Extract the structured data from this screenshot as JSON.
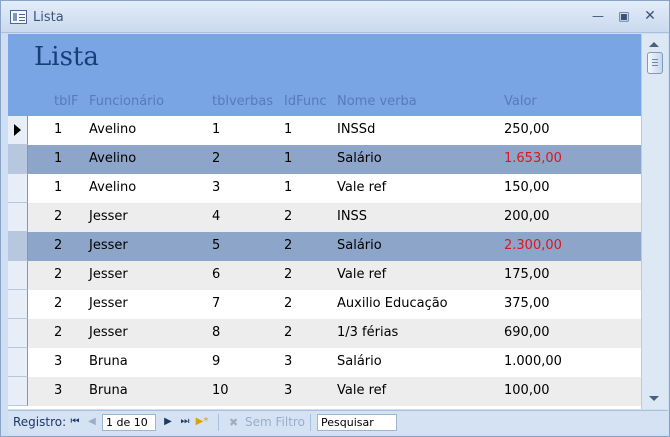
{
  "window": {
    "title": "Lista"
  },
  "form": {
    "title": "Lista"
  },
  "columns": [
    "tblF",
    "Funcionário",
    "tblverbas",
    "IdFunc",
    "Nome verba",
    "Valor"
  ],
  "rows": [
    {
      "tblF": "1",
      "funcionario": "Avelino",
      "tblverbas": "1",
      "idfunc": "1",
      "nome_verba": "INSSd",
      "valor": "250,00"
    },
    {
      "tblF": "1",
      "funcionario": "Avelino",
      "tblverbas": "2",
      "idfunc": "1",
      "nome_verba": "Salário",
      "valor": "1.653,00"
    },
    {
      "tblF": "1",
      "funcionario": "Avelino",
      "tblverbas": "3",
      "idfunc": "1",
      "nome_verba": "Vale ref",
      "valor": "150,00"
    },
    {
      "tblF": "2",
      "funcionario": "Jesser",
      "tblverbas": "4",
      "idfunc": "2",
      "nome_verba": "INSS",
      "valor": "200,00"
    },
    {
      "tblF": "2",
      "funcionario": "Jesser",
      "tblverbas": "5",
      "idfunc": "2",
      "nome_verba": "Salário",
      "valor": "2.300,00"
    },
    {
      "tblF": "2",
      "funcionario": "Jesser",
      "tblverbas": "6",
      "idfunc": "2",
      "nome_verba": "Vale ref",
      "valor": "175,00"
    },
    {
      "tblF": "2",
      "funcionario": "Jesser",
      "tblverbas": "7",
      "idfunc": "2",
      "nome_verba": "Auxilio Educação",
      "valor": "375,00"
    },
    {
      "tblF": "2",
      "funcionario": "Jesser",
      "tblverbas": "8",
      "idfunc": "2",
      "nome_verba": "1/3 férias",
      "valor": "690,00"
    },
    {
      "tblF": "3",
      "funcionario": "Bruna",
      "tblverbas": "9",
      "idfunc": "3",
      "nome_verba": "Salário",
      "valor": "1.000,00"
    },
    {
      "tblF": "3",
      "funcionario": "Bruna",
      "tblverbas": "10",
      "idfunc": "3",
      "nome_verba": "Vale ref",
      "valor": "100,00"
    }
  ],
  "navigation": {
    "label": "Registro:",
    "position": "1 de 10",
    "filter_label": "Sem Filtro",
    "search_placeholder": "Pesquisar"
  },
  "colors": {
    "header_bg": "#7aa5e5",
    "title_color": "#163f78",
    "column_header_color": "#557bb9",
    "highlight_row": "#8ca5c9",
    "alt_row": "#ededed",
    "highlight_value": "#e0141e"
  },
  "icons": {
    "window": "form-icon",
    "minimize": "minimize-icon",
    "maximize": "maximize-icon",
    "close": "close-icon",
    "current_record": "current-record-arrow-icon"
  }
}
